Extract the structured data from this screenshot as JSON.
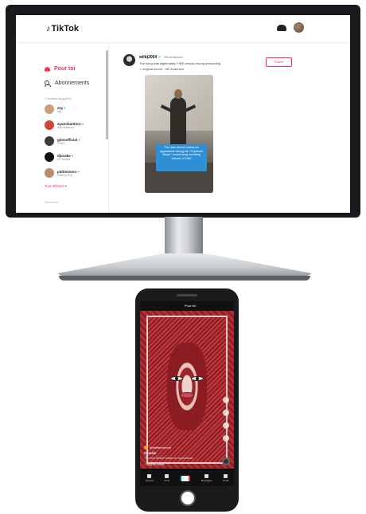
{
  "web": {
    "logo": "TikTok",
    "sidebar": {
      "nav": [
        {
          "label": "Pour toi",
          "active": true
        },
        {
          "label": "Abonnements",
          "active": false
        }
      ],
      "section_label": "Comptes suggérés",
      "accounts": [
        {
          "name": "zrg",
          "sub": "zrg",
          "color": "#c8a27a"
        },
        {
          "name": "ayanobanturo",
          "sub": "Ayo Banturo",
          "color": "#d0463c"
        },
        {
          "name": "gimsofficial",
          "sub": "GIMS",
          "color": "#3b3b3b"
        },
        {
          "name": "djsnake",
          "sub": "DJ Snake",
          "color": "#111111"
        },
        {
          "name": "pattinsonrx",
          "sub": "Patrick Rxx",
          "color": "#b98c6d"
        }
      ],
      "see_all": "Tout afficher ▾",
      "footer_hint": "Découvrir"
    },
    "post": {
      "username": "wilbj2004",
      "verified_mark": "✔",
      "handle": "Wil Anderson",
      "caption": "The song was legitimately FIRE #music #song #recording",
      "sound": "♫ original sound - Wil Anderson",
      "follow_label": "Suivre",
      "video_caption": "The man himself makes an appearance during the \"Superstar Singer\" record song recording session of 1982"
    }
  },
  "mobile": {
    "top_tab": "Pour toi",
    "user": "@whiteburnout",
    "title": "#music",
    "caption": "The man himself makes an appearance",
    "sound": "♫ original sound",
    "nav": [
      {
        "label": "Accueil"
      },
      {
        "label": "Amis"
      },
      {
        "label": ""
      },
      {
        "label": "Messages"
      },
      {
        "label": "Profil"
      }
    ]
  }
}
